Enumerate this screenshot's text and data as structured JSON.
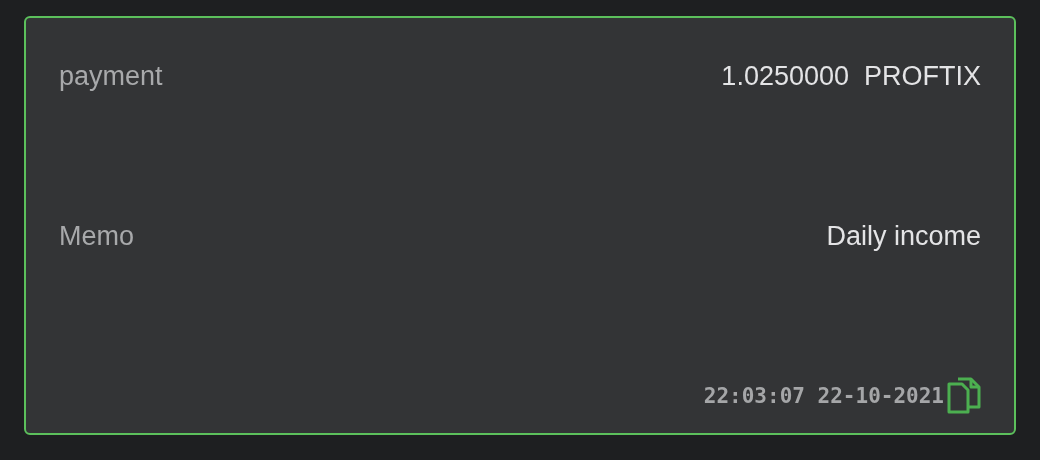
{
  "transaction": {
    "rows": [
      {
        "label": "payment",
        "value": "1.0250000  PROFTIX"
      },
      {
        "label": "Memo",
        "value": "Daily income"
      }
    ],
    "timestamp": "22:03:07 22-10-2021"
  }
}
